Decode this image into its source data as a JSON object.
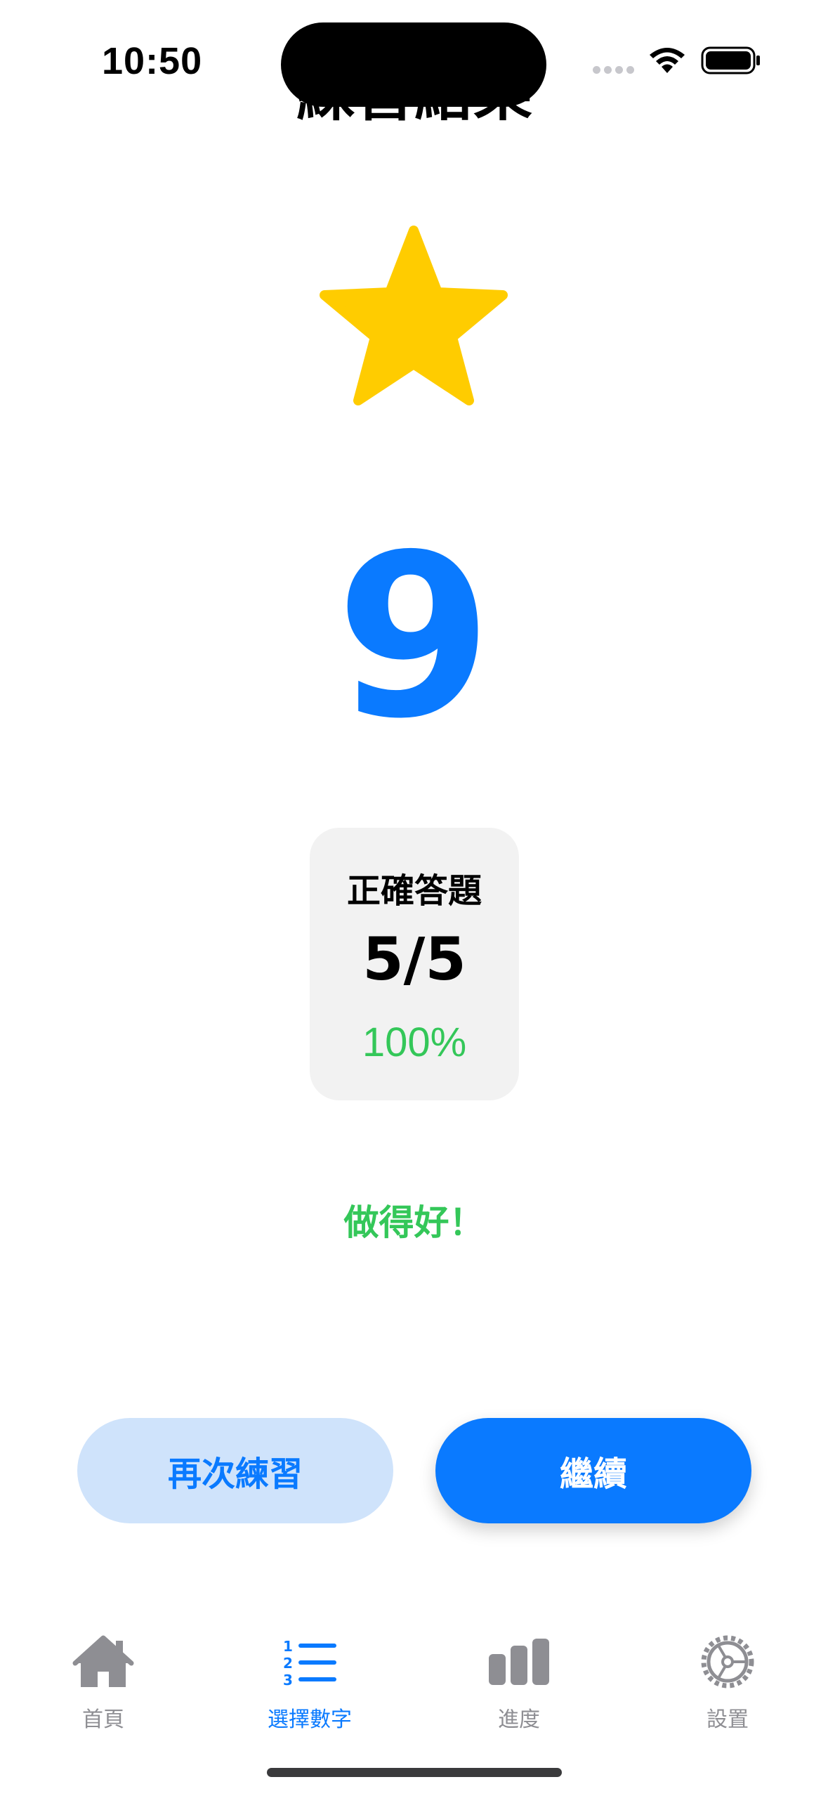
{
  "status_bar": {
    "time": "10:50"
  },
  "nav": {
    "title": "練習結果"
  },
  "result": {
    "target_number": "9",
    "card_label": "正確答題",
    "score": "5/5",
    "percent": "100%",
    "feedback": "做得好！"
  },
  "buttons": {
    "retry_label": "再次練習",
    "continue_label": "繼續"
  },
  "tabs": [
    {
      "label": "首頁",
      "icon": "house-icon",
      "active": false
    },
    {
      "label": "選擇數字",
      "icon": "numbered-list-icon",
      "active": true
    },
    {
      "label": "進度",
      "icon": "bar-chart-icon",
      "active": false
    },
    {
      "label": "設置",
      "icon": "gear-icon",
      "active": false
    }
  ],
  "colors": {
    "accent": "#0a7aff",
    "success": "#34c759",
    "star": "#ffcc00",
    "inactive": "#8e8e93"
  }
}
